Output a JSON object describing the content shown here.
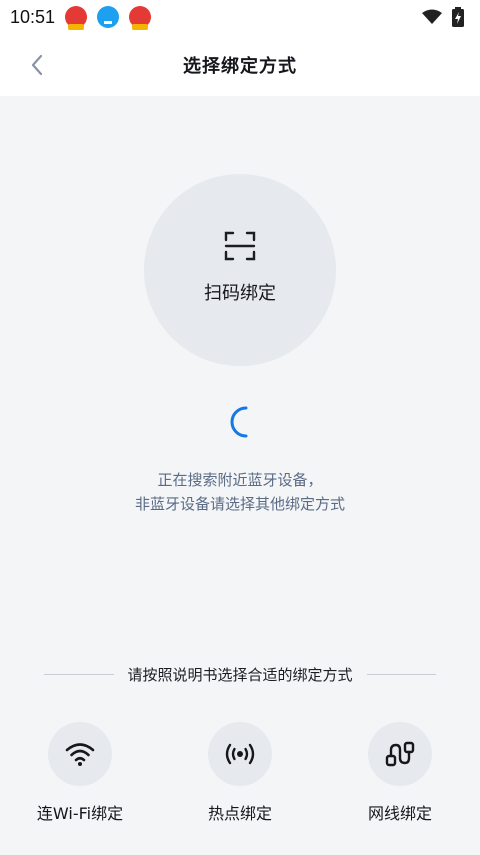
{
  "status_bar": {
    "time": "10:51",
    "notification_icons": [
      "app-notification-icon",
      "download-icon",
      "app-notification-icon"
    ]
  },
  "nav": {
    "title": "选择绑定方式",
    "back_icon": "chevron-left-icon"
  },
  "scan": {
    "label": "扫码绑定",
    "icon": "scan-frame-icon"
  },
  "searching": {
    "line1": "正在搜索附近蓝牙设备，",
    "line2": "非蓝牙设备请选择其他绑定方式"
  },
  "divider_text": "请按照说明书选择合适的绑定方式",
  "options": [
    {
      "label": "连Wi-Fi绑定",
      "icon": "wifi-icon"
    },
    {
      "label": "热点绑定",
      "icon": "hotspot-icon"
    },
    {
      "label": "网线绑定",
      "icon": "network-cable-icon"
    }
  ],
  "colors": {
    "accent": "#1677e6",
    "background": "#f3f5f7",
    "circle": "#e6e9ee",
    "hint_text": "#5b6b85"
  }
}
